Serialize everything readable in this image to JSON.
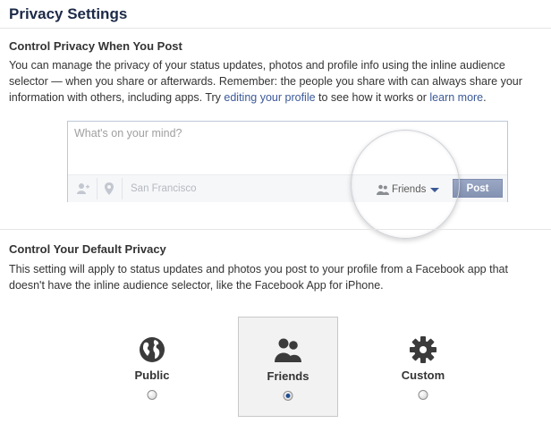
{
  "page": {
    "title": "Privacy Settings"
  },
  "post_section": {
    "heading": "Control Privacy When You Post",
    "text_before_link1": "You can manage the privacy of your status updates, photos and profile info using the inline audience selector — when you share or afterwards. Remember: the people you share with can always share your information with others, including apps. Try ",
    "link1": "editing your profile",
    "text_between": " to see how it works or ",
    "link2": "learn more",
    "text_end": "."
  },
  "composer": {
    "placeholder": "What's on your mind?",
    "location": "San Francisco",
    "audience": "Friends",
    "post_label": "Post",
    "icons": {
      "tag": "tag-people-icon",
      "location": "location-pin-icon",
      "audience": "friends-icon"
    }
  },
  "default_section": {
    "heading": "Control Your Default Privacy",
    "text": "This setting will apply to status updates and photos you post to your profile from a Facebook app that doesn't have the inline audience selector, like the Facebook App for iPhone."
  },
  "options": [
    {
      "label": "Public",
      "icon": "globe-icon",
      "selected": false
    },
    {
      "label": "Friends",
      "icon": "friends-icon",
      "selected": true
    },
    {
      "label": "Custom",
      "icon": "gear-icon",
      "selected": false
    }
  ],
  "colors": {
    "link": "#3b5998",
    "heading": "#1c2a47",
    "post_button": "#8f9cbc",
    "radio_selected": "#1e4f8f"
  }
}
